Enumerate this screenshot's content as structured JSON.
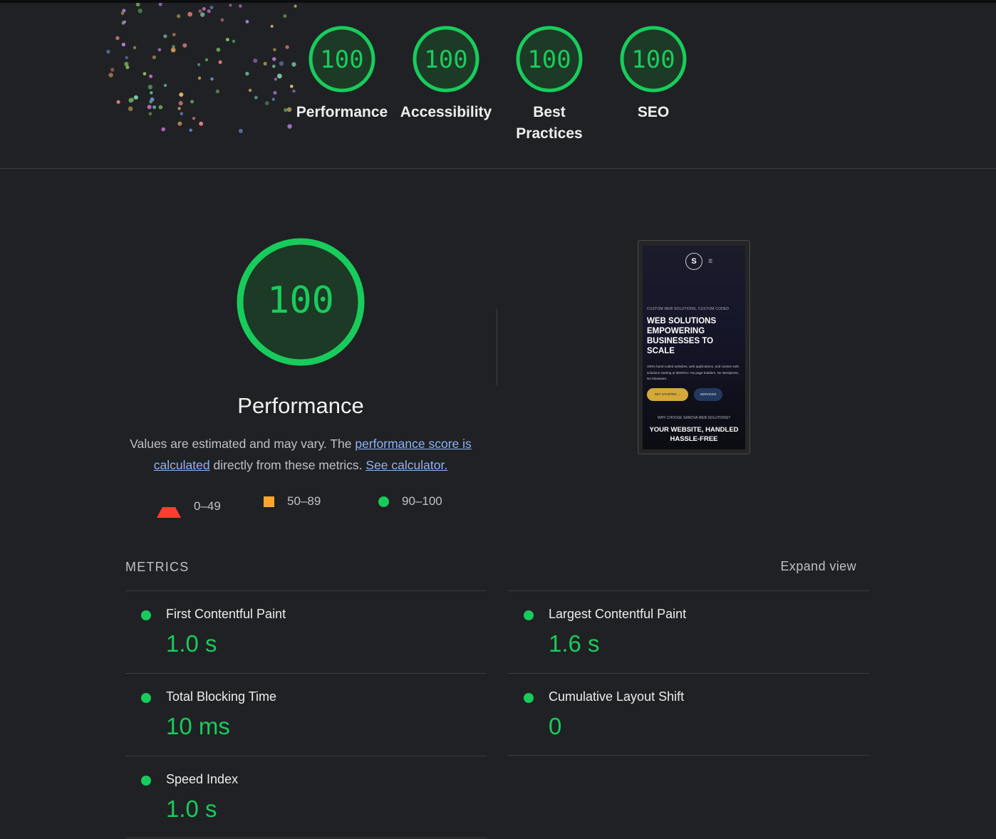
{
  "categories": [
    {
      "score": "100",
      "label": "Performance"
    },
    {
      "score": "100",
      "label": "Accessibility"
    },
    {
      "score": "100",
      "label": "Best Practices"
    },
    {
      "score": "100",
      "label": "SEO"
    }
  ],
  "performance": {
    "score": "100",
    "title": "Performance",
    "desc_prefix": "Values are estimated and may vary. The ",
    "desc_link1": "performance score is calculated",
    "desc_middle": " directly from these metrics. ",
    "desc_link2": "See calculator."
  },
  "legend": [
    {
      "shape": "triangle",
      "range": "0–49",
      "color": "#ff3d2e"
    },
    {
      "shape": "square",
      "range": "50–89",
      "color": "#ffa62b"
    },
    {
      "shape": "circle",
      "range": "90–100",
      "color": "#18cc5c"
    }
  ],
  "screenshot": {
    "logo": "S",
    "eyebrow": "CUSTOM WEB SOLUTIONS, CUSTOM CODED",
    "headline": "WEB SOLUTIONS EMPOWERING BUSINESSES TO SCALE",
    "body": "100% hand-coded websites, web applications, and custom web solutions starting at $200/mo. No page builders, No Wordpress, No bloatware.",
    "cta_primary": "GET STARTED →",
    "cta_secondary": "SERVICES",
    "why": "WHY CHOOSE SANOVA WEB SOLUTIONS?",
    "subhead": "YOUR WEBSITE, HANDLED HASSLE-FREE"
  },
  "metrics": {
    "heading": "METRICS",
    "expand_label": "Expand view",
    "items": [
      {
        "label": "First Contentful Paint",
        "value": "1.0 s"
      },
      {
        "label": "Largest Contentful Paint",
        "value": "1.6 s"
      },
      {
        "label": "Total Blocking Time",
        "value": "10 ms"
      },
      {
        "label": "Cumulative Layout Shift",
        "value": "0"
      },
      {
        "label": "Speed Index",
        "value": "1.0 s"
      }
    ]
  },
  "colors": {
    "pass": "#18cc5c",
    "pass_bg": "#1d3a26",
    "background": "#202124"
  }
}
